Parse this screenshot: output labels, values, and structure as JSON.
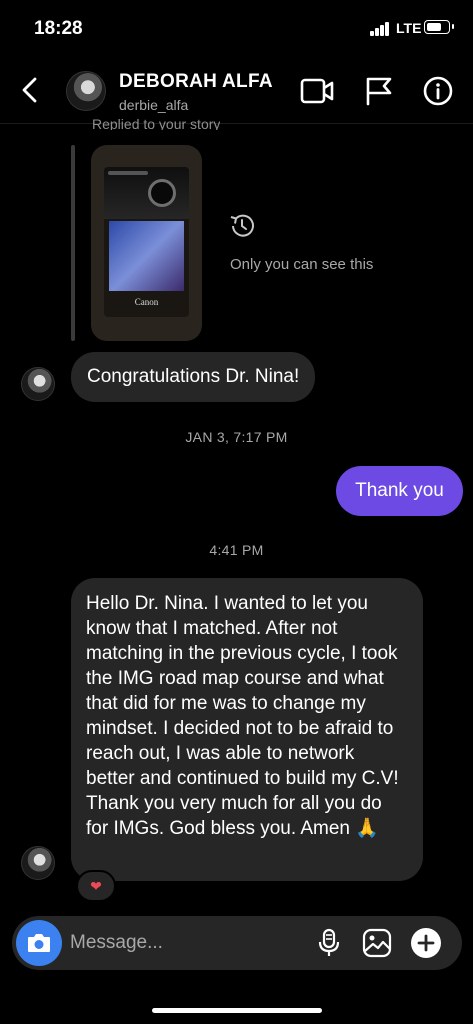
{
  "status_bar": {
    "time": "18:28",
    "network": "LTE",
    "battery_level": 0.75
  },
  "header": {
    "name": "DEBORAH ALFA",
    "username": "derbie_alfa"
  },
  "story_reply": {
    "replied_label": "Replied to your story",
    "story_brand": "Canon",
    "visibility_note": "Only you can see this"
  },
  "messages": {
    "incoming_1": "Congratulations Dr. Nina!",
    "timestamp_1": "JAN 3, 7:17 PM",
    "outgoing_1": "Thank you",
    "timestamp_2": "4:41 PM",
    "incoming_2": "Hello Dr. Nina. I wanted to let you know that I matched. After not matching in the previous cycle, I took the IMG road map course and what that did for me was to change my mindset. I decided not to be afraid to reach out, I was able to network better and continued to build my C.V! Thank you very much for all you do for IMGs. God bless you. Amen 🙏",
    "reaction": "❤"
  },
  "composer": {
    "placeholder": "Message..."
  },
  "colors": {
    "outgoing_bubble": "#6c4ae3",
    "incoming_bubble": "#262626",
    "camera_button": "#3b82f0",
    "reaction": "#ed4956"
  },
  "icons": [
    "back-icon",
    "video-call-icon",
    "flag-icon",
    "info-icon",
    "history-icon",
    "camera-icon",
    "microphone-icon",
    "gallery-icon",
    "plus-icon"
  ]
}
